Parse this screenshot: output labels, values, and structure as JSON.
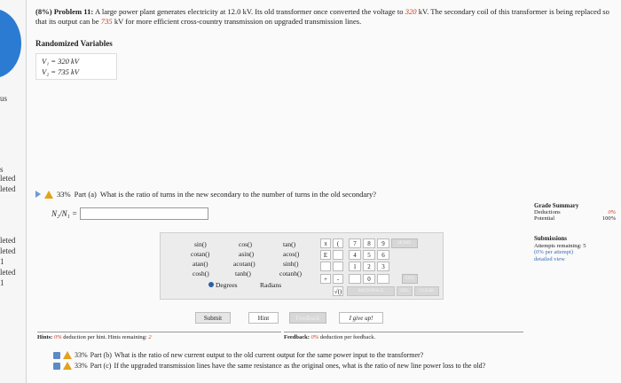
{
  "sidebar": {
    "items": [
      "us",
      "s",
      "leted",
      "leted",
      "leted",
      "leted",
      "1",
      "leted",
      "1"
    ]
  },
  "problem": {
    "heading": "(8%) Problem 11:",
    "text_1": "A large power plant generates electricity at 12.0 kV. Its old transformer once converted the voltage to",
    "v1_value": "320",
    "text_2": "kV. The secondary coil of this",
    "text_3": "transformer is being replaced so that its output can be",
    "v2_value": "735",
    "text_4": "kV for more efficient cross-country transmission on upgraded transmission lines."
  },
  "randomized": {
    "title": "Randomized Variables",
    "v1": "V₁ = 320 kV",
    "v2": "V₂ = 735 kV"
  },
  "part_a": {
    "percent": "33%",
    "label": "Part (a)",
    "question": "What is the ratio of turns in the new secondary to the number of turns in the old secondary?",
    "answer_label": "N₂/N₁ =",
    "answer_value": ""
  },
  "grade_summary": {
    "title": "Grade Summary",
    "deductions_label": "Deductions",
    "deductions_value": "0%",
    "potential_label": "Potential",
    "potential_value": "100%"
  },
  "submissions": {
    "title": "Submissions",
    "attempts": "Attempts remaining: 5",
    "per_attempt": "(0% per attempt)",
    "detailed": "detailed view"
  },
  "calculator": {
    "functions": [
      [
        "sin()",
        "cos()",
        "tan()"
      ],
      [
        "cotan()",
        "asin()",
        "acos()"
      ],
      [
        "atan()",
        "acotan()",
        "sinh()"
      ],
      [
        "cosh()",
        "tanh()",
        "cotanh()"
      ]
    ],
    "degrees": "Degrees",
    "radians": "Radians",
    "symbols": [
      "π",
      "(",
      "E",
      "",
      "",
      "",
      "+",
      "-",
      "√()",
      ""
    ],
    "digits": [
      "7",
      "8",
      "9",
      "4",
      "5",
      "6",
      "1",
      "2",
      "3",
      "",
      "0",
      ""
    ],
    "home": "HOME",
    "end": "END",
    "backspace": "BACKSPACE",
    "del": "DEL",
    "clear": "CLEAR"
  },
  "actions": {
    "submit": "Submit",
    "hint": "Hint",
    "feedback": "Feedback",
    "give_up": "I give up!"
  },
  "hints": {
    "label": "Hints:",
    "pct": "0%",
    "text": "deduction per hint. Hints remaining:",
    "remaining": "2"
  },
  "feedback": {
    "label": "Feedback:",
    "pct": "0%",
    "text": "deduction per feedback."
  },
  "part_b": {
    "percent": "33%",
    "label": "Part (b)",
    "question": "What is the ratio of new current output to the old current output for the same power input to the transformer?"
  },
  "part_c": {
    "percent": "33%",
    "label": "Part (c)",
    "question": "If the upgraded transmission lines have the same resistance as the original ones, what is the ratio of new line power loss to the old?"
  }
}
